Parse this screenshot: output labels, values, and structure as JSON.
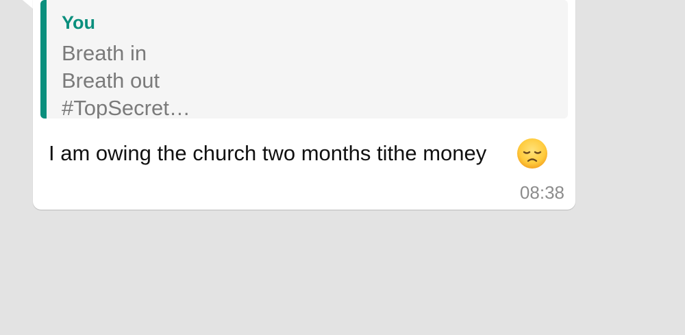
{
  "message": {
    "quote": {
      "author": "You",
      "lines": [
        "Breath in",
        "Breath out",
        "#TopSecret…"
      ]
    },
    "text": "I am owing the church two months tithe money",
    "emoji": "pensive-face",
    "time": "08:38"
  },
  "colors": {
    "background": "#e3e3e3",
    "bubble": "#ffffff",
    "quote_background": "#f5f5f5",
    "quote_accent": "#0a8f7d",
    "quote_text": "#7a7a7a",
    "message_text": "#111111",
    "timestamp": "#8c8c8c"
  }
}
